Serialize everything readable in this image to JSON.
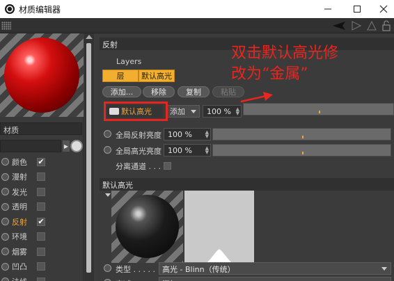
{
  "window": {
    "title": "材质编辑器",
    "minimize_icon": "minimize-icon",
    "maximize_icon": "maximize-icon",
    "close_icon": "close-icon"
  },
  "material": {
    "name": "材质"
  },
  "channels": [
    {
      "label": "颜色",
      "checked": true,
      "active": false
    },
    {
      "label": "漫射",
      "checked": false,
      "active": false
    },
    {
      "label": "发光",
      "checked": false,
      "active": false
    },
    {
      "label": "透明",
      "checked": false,
      "active": false
    },
    {
      "label": "反射",
      "checked": true,
      "active": true
    },
    {
      "label": "环境",
      "checked": false,
      "active": false
    },
    {
      "label": "烟雾",
      "checked": false,
      "active": false
    },
    {
      "label": "凹凸",
      "checked": false,
      "active": false
    },
    {
      "label": "法线",
      "checked": false,
      "active": false
    }
  ],
  "reflection": {
    "section_title": "反射",
    "layers_label": "Layers",
    "tab_layer": "层",
    "tab_default_specular": "默认高光",
    "btn_add": "添加...",
    "btn_remove": "移除",
    "btn_copy": "复制",
    "btn_paste": "粘贴",
    "layer_name": "默认高光",
    "layer_blend": "添加",
    "layer_strength": "100 %",
    "global_reflect_label": "全局反射亮度",
    "global_reflect_value": "100 %",
    "global_specular_label": "全局高光亮度",
    "global_specular_value": "100 %",
    "separate_pass_label": "分离通道 . . . ."
  },
  "specular": {
    "section_title": "默认高光",
    "type_label": "类型 . . . . .",
    "type_value": "高光 - Blinn（传统）",
    "next_label": "衰减",
    "next_value": "添加"
  },
  "annotation": {
    "text": "双击默认高光修\n改为“金属”",
    "color": "#e8261f"
  },
  "colors": {
    "accent": "#f0a632",
    "tab_bg": "#f2ae2e",
    "highlight_box": "#e8261f"
  }
}
